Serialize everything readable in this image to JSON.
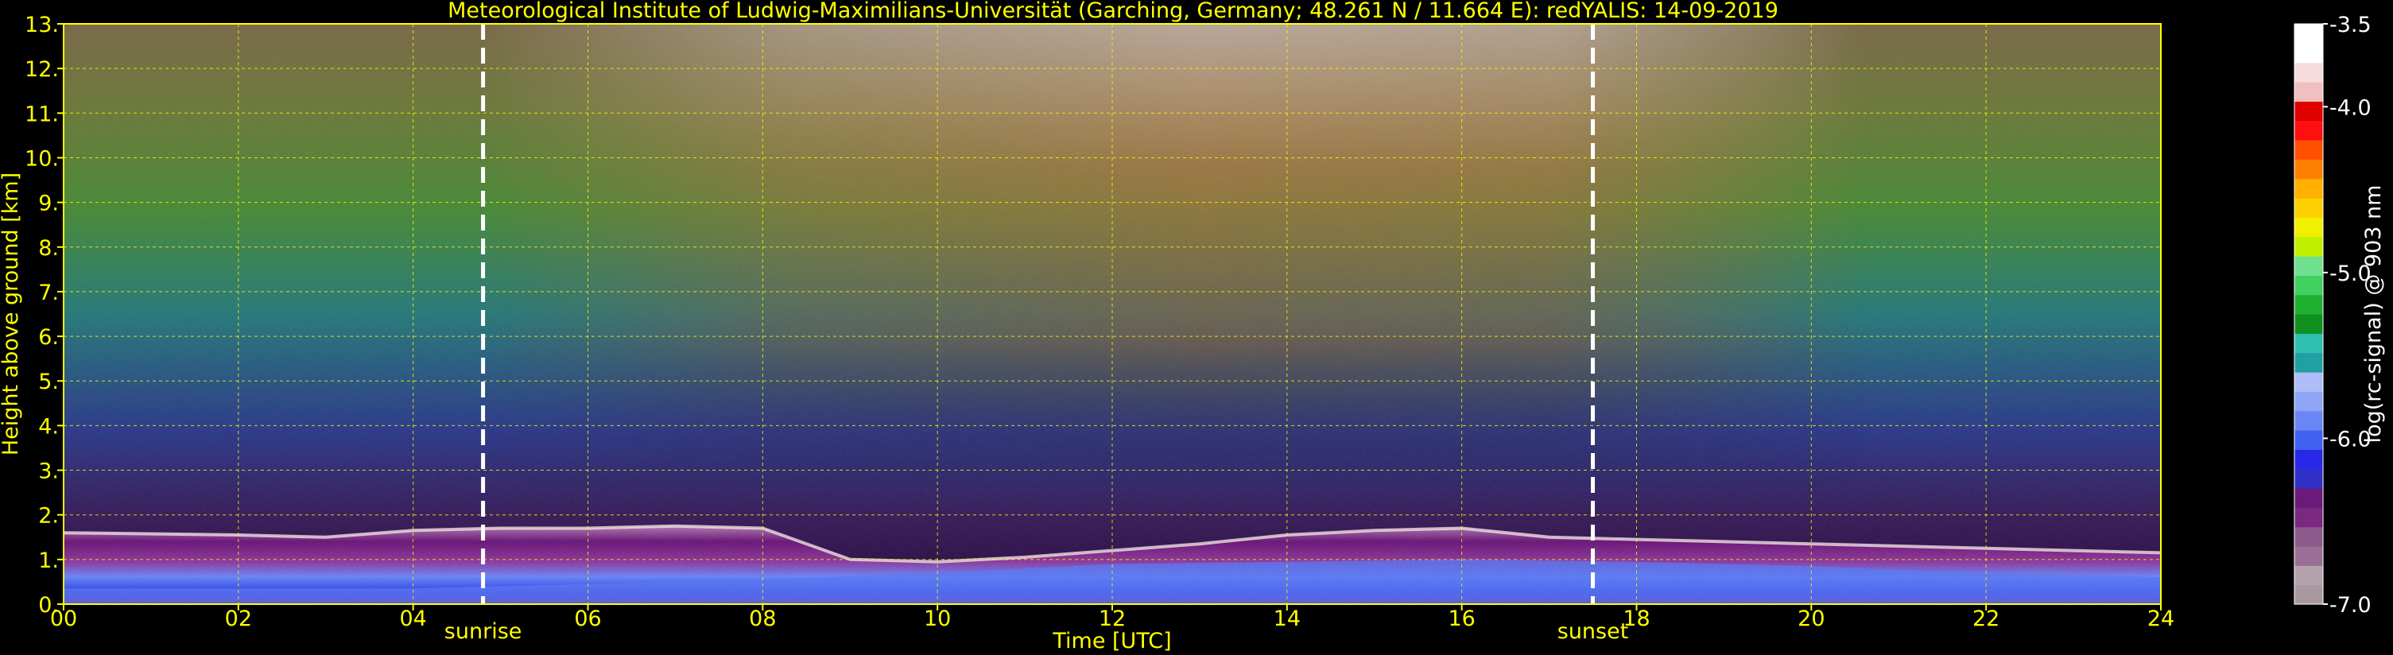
{
  "chart_data": {
    "type": "heatmap",
    "title": "Meteorological Institute of Ludwig-Maximilians-Universität (Garching, Germany; 48.261 N / 11.664 E):    redYALIS: 14-09-2019",
    "xlabel": "Time [UTC]",
    "ylabel": "Height above ground [km]",
    "x_ticks": [
      "00",
      "02",
      "04",
      "06",
      "08",
      "10",
      "12",
      "14",
      "16",
      "18",
      "20",
      "22",
      "24"
    ],
    "y_ticks": [
      "0.",
      "1.",
      "2.",
      "3.",
      "4.",
      "5.",
      "6.",
      "7.",
      "8.",
      "9.",
      "10.",
      "11.",
      "12.",
      "13."
    ],
    "xlim": [
      0,
      24
    ],
    "ylim": [
      0,
      13
    ],
    "grid": true,
    "colorbar": {
      "label": "log(rc-signal) @ 903 nm",
      "range": [
        -7.0,
        -3.5
      ],
      "tick_labels": [
        "-3.5",
        "-4.0",
        "-5.0",
        "-6.0",
        "-7.0"
      ],
      "tick_values": [
        -3.5,
        -4.0,
        -5.0,
        -6.0,
        -7.0
      ],
      "colors": [
        "#a898a0",
        "#b3a3ac",
        "#9a6e96",
        "#8c5a8a",
        "#7a2880",
        "#6a1a78",
        "#3030c8",
        "#2828e8",
        "#4060f0",
        "#6a86f4",
        "#8fa6f6",
        "#aebcf7",
        "#20a0a0",
        "#30c0b0",
        "#109020",
        "#20b030",
        "#40d060",
        "#70e090",
        "#c0f000",
        "#f0f000",
        "#ffd000",
        "#ffb000",
        "#ff8000",
        "#ff5000",
        "#ff1010",
        "#e00000",
        "#f0c0c0",
        "#f6dcdc",
        "#ffffff",
        "#ffffff"
      ]
    },
    "markers": [
      {
        "label": "sunrise",
        "x": 4.8
      },
      {
        "label": "sunset",
        "x": 17.5
      }
    ]
  }
}
